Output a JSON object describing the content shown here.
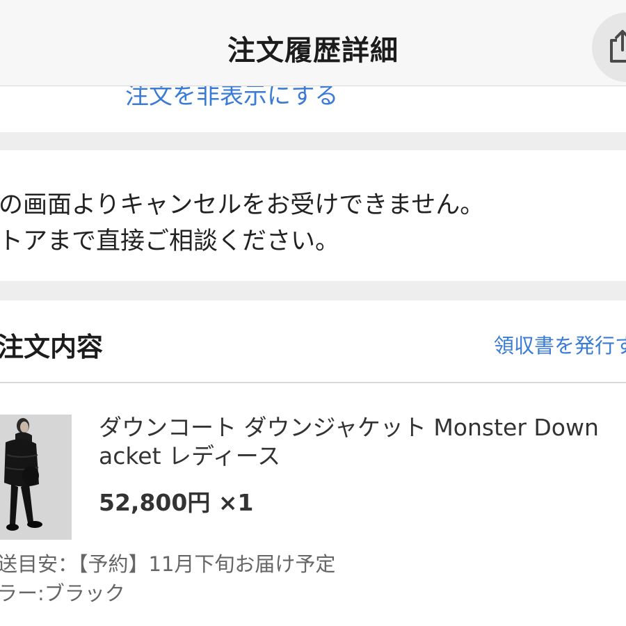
{
  "header": {
    "title": "注文履歴詳細",
    "share_icon": "share-icon"
  },
  "hide_order_link": "注文を非表示にする",
  "cancel_notice": {
    "line1": "の画面よりキャンセルをお受けできません。",
    "line2": "トアまで直接ご相談ください。"
  },
  "order_section": {
    "title": "注文内容",
    "receipt_link": "領収書を発行す"
  },
  "product": {
    "image_icon": "product-photo",
    "name_line1": "ダウンコート ダウンジャケット Monster Down",
    "name_line2": "acket レディース",
    "price": "52,800円",
    "quantity": "×1",
    "delivery": "送目安：【予約】11月下旬お届け予定",
    "color": "ラー:ブラック"
  },
  "colors": {
    "link": "#3a7bd5",
    "header_bg": "#f7f7f7",
    "divider_bg": "#eeeeee"
  }
}
